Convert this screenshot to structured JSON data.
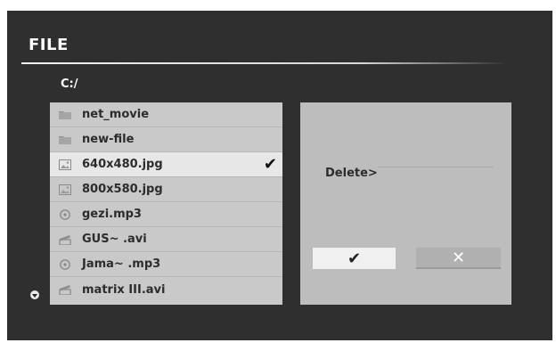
{
  "dialog": {
    "title": "FILE",
    "path": "C:/"
  },
  "files": [
    {
      "name": "net_movie",
      "icon": "folder-icon"
    },
    {
      "name": "new-file",
      "icon": "folder-icon"
    },
    {
      "name": "640x480.jpg",
      "icon": "image-icon",
      "selected": true,
      "checked": "✔"
    },
    {
      "name": "800x580.jpg",
      "icon": "image-icon"
    },
    {
      "name": "gezi.mp3",
      "icon": "music-icon"
    },
    {
      "name": "GUS~ .avi",
      "icon": "video-icon"
    },
    {
      "name": "Jama~ .mp3",
      "icon": "music-icon"
    },
    {
      "name": "matrix III.avi",
      "icon": "video-icon"
    }
  ],
  "action_panel": {
    "delete_label": "Delete>",
    "confirm_label": "✔",
    "cancel_label": "✕"
  }
}
